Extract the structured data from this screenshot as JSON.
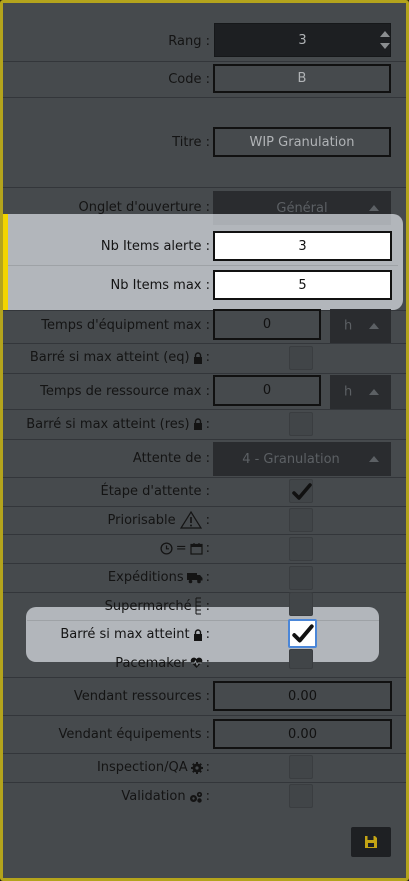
{
  "form": {
    "rang": {
      "label": "Rang :",
      "value": "3"
    },
    "code": {
      "label": "Code :",
      "value": "B"
    },
    "titre": {
      "label": "Titre :",
      "value": "WIP Granulation"
    },
    "onglet": {
      "label": "Onglet d'ouverture :",
      "value": "Général"
    },
    "nb_alerte": {
      "label": "Nb Items alerte :",
      "value": "3"
    },
    "nb_max": {
      "label": "Nb Items max :",
      "value": "5"
    },
    "temps_eq": {
      "label": "Temps d'équipment max :",
      "value": "0",
      "unit": "h"
    },
    "barre_eq": {
      "label": "Barré si max atteint (eq)",
      "suffix": ":"
    },
    "temps_res": {
      "label": "Temps de ressource max :",
      "value": "0",
      "unit": "h"
    },
    "barre_res": {
      "label": "Barré si max atteint (res)",
      "suffix": ":"
    },
    "attente": {
      "label": "Attente de :",
      "value": "4 - Granulation"
    },
    "etape": {
      "label": "Étape d'attente :",
      "checked": true
    },
    "priorisable": {
      "label": "Priorisable",
      "suffix": ":",
      "icon": "warning-icon"
    },
    "clock_eq": {
      "label": "=",
      "suffix": ":",
      "icons": [
        "clock-icon",
        "calendar-icon"
      ]
    },
    "expeditions": {
      "label": "Expéditions",
      "suffix": ":",
      "icon": "truck-icon"
    },
    "supermarche": {
      "label": "Supermarché",
      "suffix": ":",
      "icon": "shelf-icon"
    },
    "barre_max": {
      "label": "Barré si max atteint",
      "suffix": ":",
      "checked": true,
      "icon": "lock-icon"
    },
    "pacemaker": {
      "label": "Pacemaker",
      "suffix": ":",
      "icon": "heartbeat-icon"
    },
    "vendant_res": {
      "label": "Vendant ressources :",
      "value": "0.00"
    },
    "vendant_eq": {
      "label": "Vendant équipements :",
      "value": "0.00"
    },
    "inspection": {
      "label": "Inspection/QA",
      "suffix": ":",
      "icon": "gear-icon"
    },
    "validation": {
      "label": "Validation",
      "suffix": ":",
      "icon": "cogs-icon"
    }
  },
  "colors": {
    "frame": "#b4a41c",
    "panel": "#464a4d",
    "highlight_bar": "#f2d400",
    "focus": "#4a86d8"
  }
}
